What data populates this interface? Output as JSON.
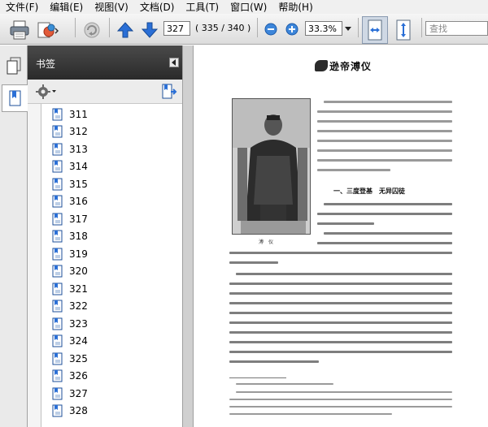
{
  "menu": {
    "items": [
      "文件(F)",
      "编辑(E)",
      "视图(V)",
      "文档(D)",
      "工具(T)",
      "窗口(W)",
      "帮助(H)"
    ]
  },
  "toolbar": {
    "current_page": "327",
    "page_count": "( 335 / 340 )",
    "zoom": "33.3%",
    "search_placeholder": "查找"
  },
  "icons": {
    "print": "printer-icon",
    "export": "export-icon",
    "refresh": "refresh-icon",
    "prev_page": "arrow-up-icon",
    "next_page": "arrow-down-icon",
    "zoom_out": "minus-circle-icon",
    "zoom_in": "plus-circle-icon",
    "fit_width": "fit-width-icon",
    "fit_page": "fit-page-icon",
    "pages_panel": "pages-icon",
    "bookmarks_panel": "bookmark-icon",
    "options": "gear-icon",
    "bookmark_page": "bookmark-page-icon"
  },
  "bookmarks": {
    "title": "书签",
    "items": [
      "311",
      "312",
      "313",
      "314",
      "315",
      "316",
      "317",
      "318",
      "319",
      "320",
      "321",
      "322",
      "323",
      "324",
      "325",
      "326",
      "327",
      "328"
    ]
  },
  "document": {
    "page_title": "逊帝溥仪",
    "section_heading": "一、三度登基　无异囚徒",
    "photo_caption": "溥　仪"
  },
  "colors": {
    "toolbar_bg": "#e6e6e6",
    "panel_header_bg": "#333333",
    "accent_blue": "#2a6fd6"
  }
}
